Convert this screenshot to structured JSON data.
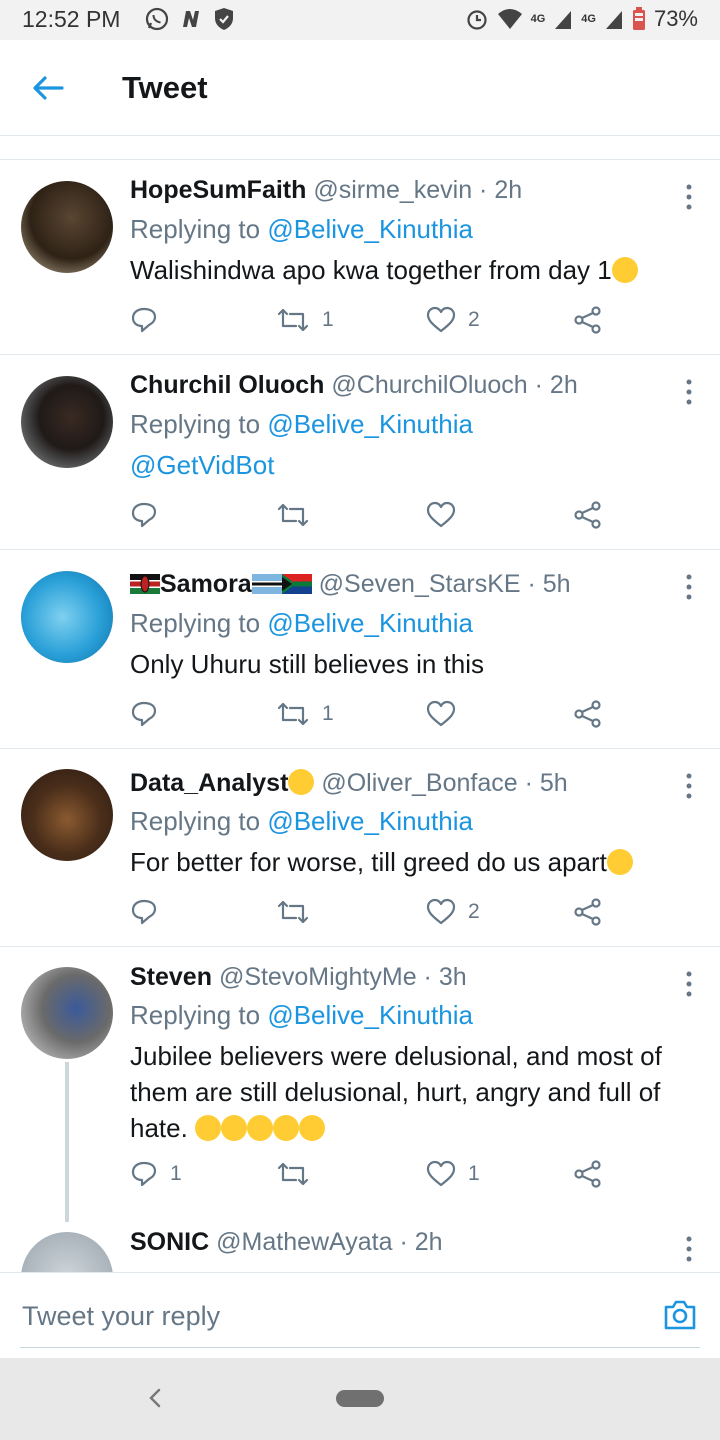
{
  "status_bar": {
    "time": "12:52 PM",
    "network_4g_a": "4G",
    "network_4g_b": "4G",
    "battery": "73%"
  },
  "app_bar": {
    "title": "Tweet"
  },
  "tweets": [
    {
      "name": "HopeSumFaith",
      "handle": "@sirme_kevin · 2h",
      "replying_prefix": "Replying to ",
      "replying_to": "@Belive_Kinuthia",
      "text": "Walishindwa apo kwa together from day 1",
      "retweets": "1",
      "likes": "2"
    },
    {
      "name": "Churchil Oluoch",
      "handle": "@ChurchilOluoch · 2h",
      "replying_prefix": "Replying to ",
      "replying_to": "@Belive_Kinuthia",
      "text": "@GetVidBot"
    },
    {
      "name": "Samora",
      "handle": "@Seven_StarsKE · 5h",
      "replying_prefix": "Replying to ",
      "replying_to": "@Belive_Kinuthia",
      "text": "Only Uhuru still believes in this",
      "retweets": "1"
    },
    {
      "name": "Data_Analyst",
      "handle": "@Oliver_Bonface · 5h",
      "replying_prefix": "Replying to ",
      "replying_to": "@Belive_Kinuthia",
      "text": "For better for worse, till greed do us apart",
      "likes": "2"
    },
    {
      "name": "Steven",
      "handle": "@StevoMightyMe · 3h",
      "replying_prefix": "Replying to ",
      "replying_to": "@Belive_Kinuthia",
      "text_line1": "Jubilee believers were delusional, and most of",
      "text_line2": "them are still delusional, hurt, angry and full of",
      "text_line3": "hate.",
      "replies": "1",
      "likes": "1"
    },
    {
      "name": "SONIC",
      "handle": "@MathewAyata · 2h"
    }
  ],
  "composer": {
    "placeholder": "Tweet your reply"
  },
  "colors": {
    "accent": "#1b95e0",
    "muted": "#657786",
    "text": "#14171a"
  }
}
